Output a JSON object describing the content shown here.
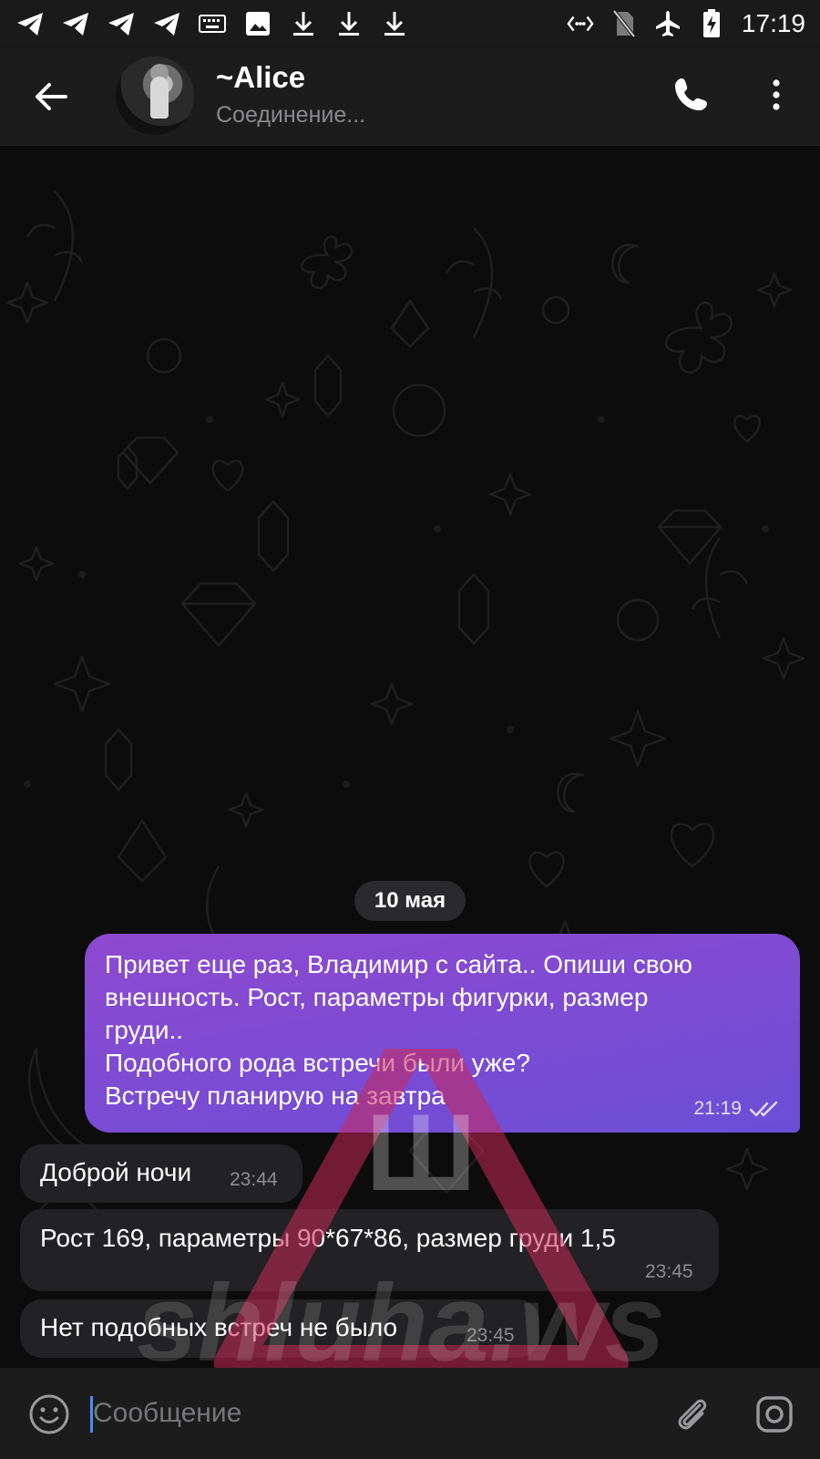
{
  "status_bar": {
    "time": "17:19",
    "left_icons": [
      "telegram-icon",
      "telegram-icon",
      "telegram-icon",
      "telegram-icon",
      "keyboard-icon",
      "image-icon",
      "download-icon",
      "download-icon",
      "download-icon"
    ],
    "right_icons": [
      "nfc-sync-icon",
      "no-sim-icon",
      "airplane-icon",
      "battery-charging-icon"
    ]
  },
  "header": {
    "title": "~Alice",
    "status": "Соединение..."
  },
  "chat": {
    "date": "10 мая",
    "messages": [
      {
        "direction": "outgoing",
        "text": "Привет еще раз, Владимир с сайта.. Опиши свою\nвнешность. Рост, параметры фигурки, размер\nгруди..\nПодобного рода встречи были уже?\nВстречу планирую на завтра",
        "time": "21:19",
        "status": "read"
      },
      {
        "direction": "incoming",
        "text": "Доброй ночи",
        "time": "23:44"
      },
      {
        "direction": "incoming",
        "text": "Рост 169, параметры 90*67*86, размер груди 1,5",
        "time": "23:45"
      },
      {
        "direction": "incoming",
        "text": "Нет подобных встреч не было",
        "time": "23:45"
      }
    ]
  },
  "watermark": {
    "glyph": "Ш",
    "text": "shluha.ws"
  },
  "input": {
    "placeholder": "Сообщение",
    "value": ""
  },
  "colors": {
    "accent": "#4c8df6",
    "outgoing_bubble_top": "#8e49cf",
    "outgoing_bubble_bottom": "#6b4ed6",
    "incoming_bubble": "#222224"
  }
}
